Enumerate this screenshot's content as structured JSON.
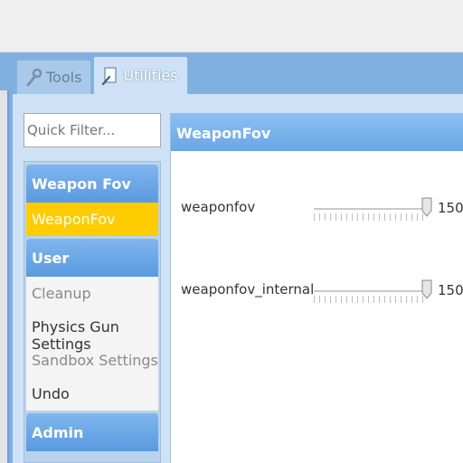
{
  "tabs": [
    {
      "label": "Tools",
      "icon": "wrench-icon"
    },
    {
      "label": "Utilities",
      "icon": "page-icon"
    }
  ],
  "filter": {
    "placeholder": "Quick Filter..."
  },
  "categories": {
    "weapon_fov": {
      "title": "Weapon Fov",
      "items": [
        "WeaponFov"
      ]
    },
    "user": {
      "title": "User",
      "items": [
        "Cleanup",
        "Physics Gun Settings",
        "Sandbox Settings",
        "Undo"
      ]
    },
    "admin": {
      "title": "Admin"
    }
  },
  "content": {
    "title": "WeaponFov",
    "sliders": [
      {
        "label": "weaponfov",
        "value": "150",
        "level": 1.0
      },
      {
        "label": "weaponfov_internal",
        "value": "150",
        "level": 1.0
      }
    ]
  },
  "colors": {
    "accent": "#6aa6e6",
    "selected": "#ffcc00"
  }
}
